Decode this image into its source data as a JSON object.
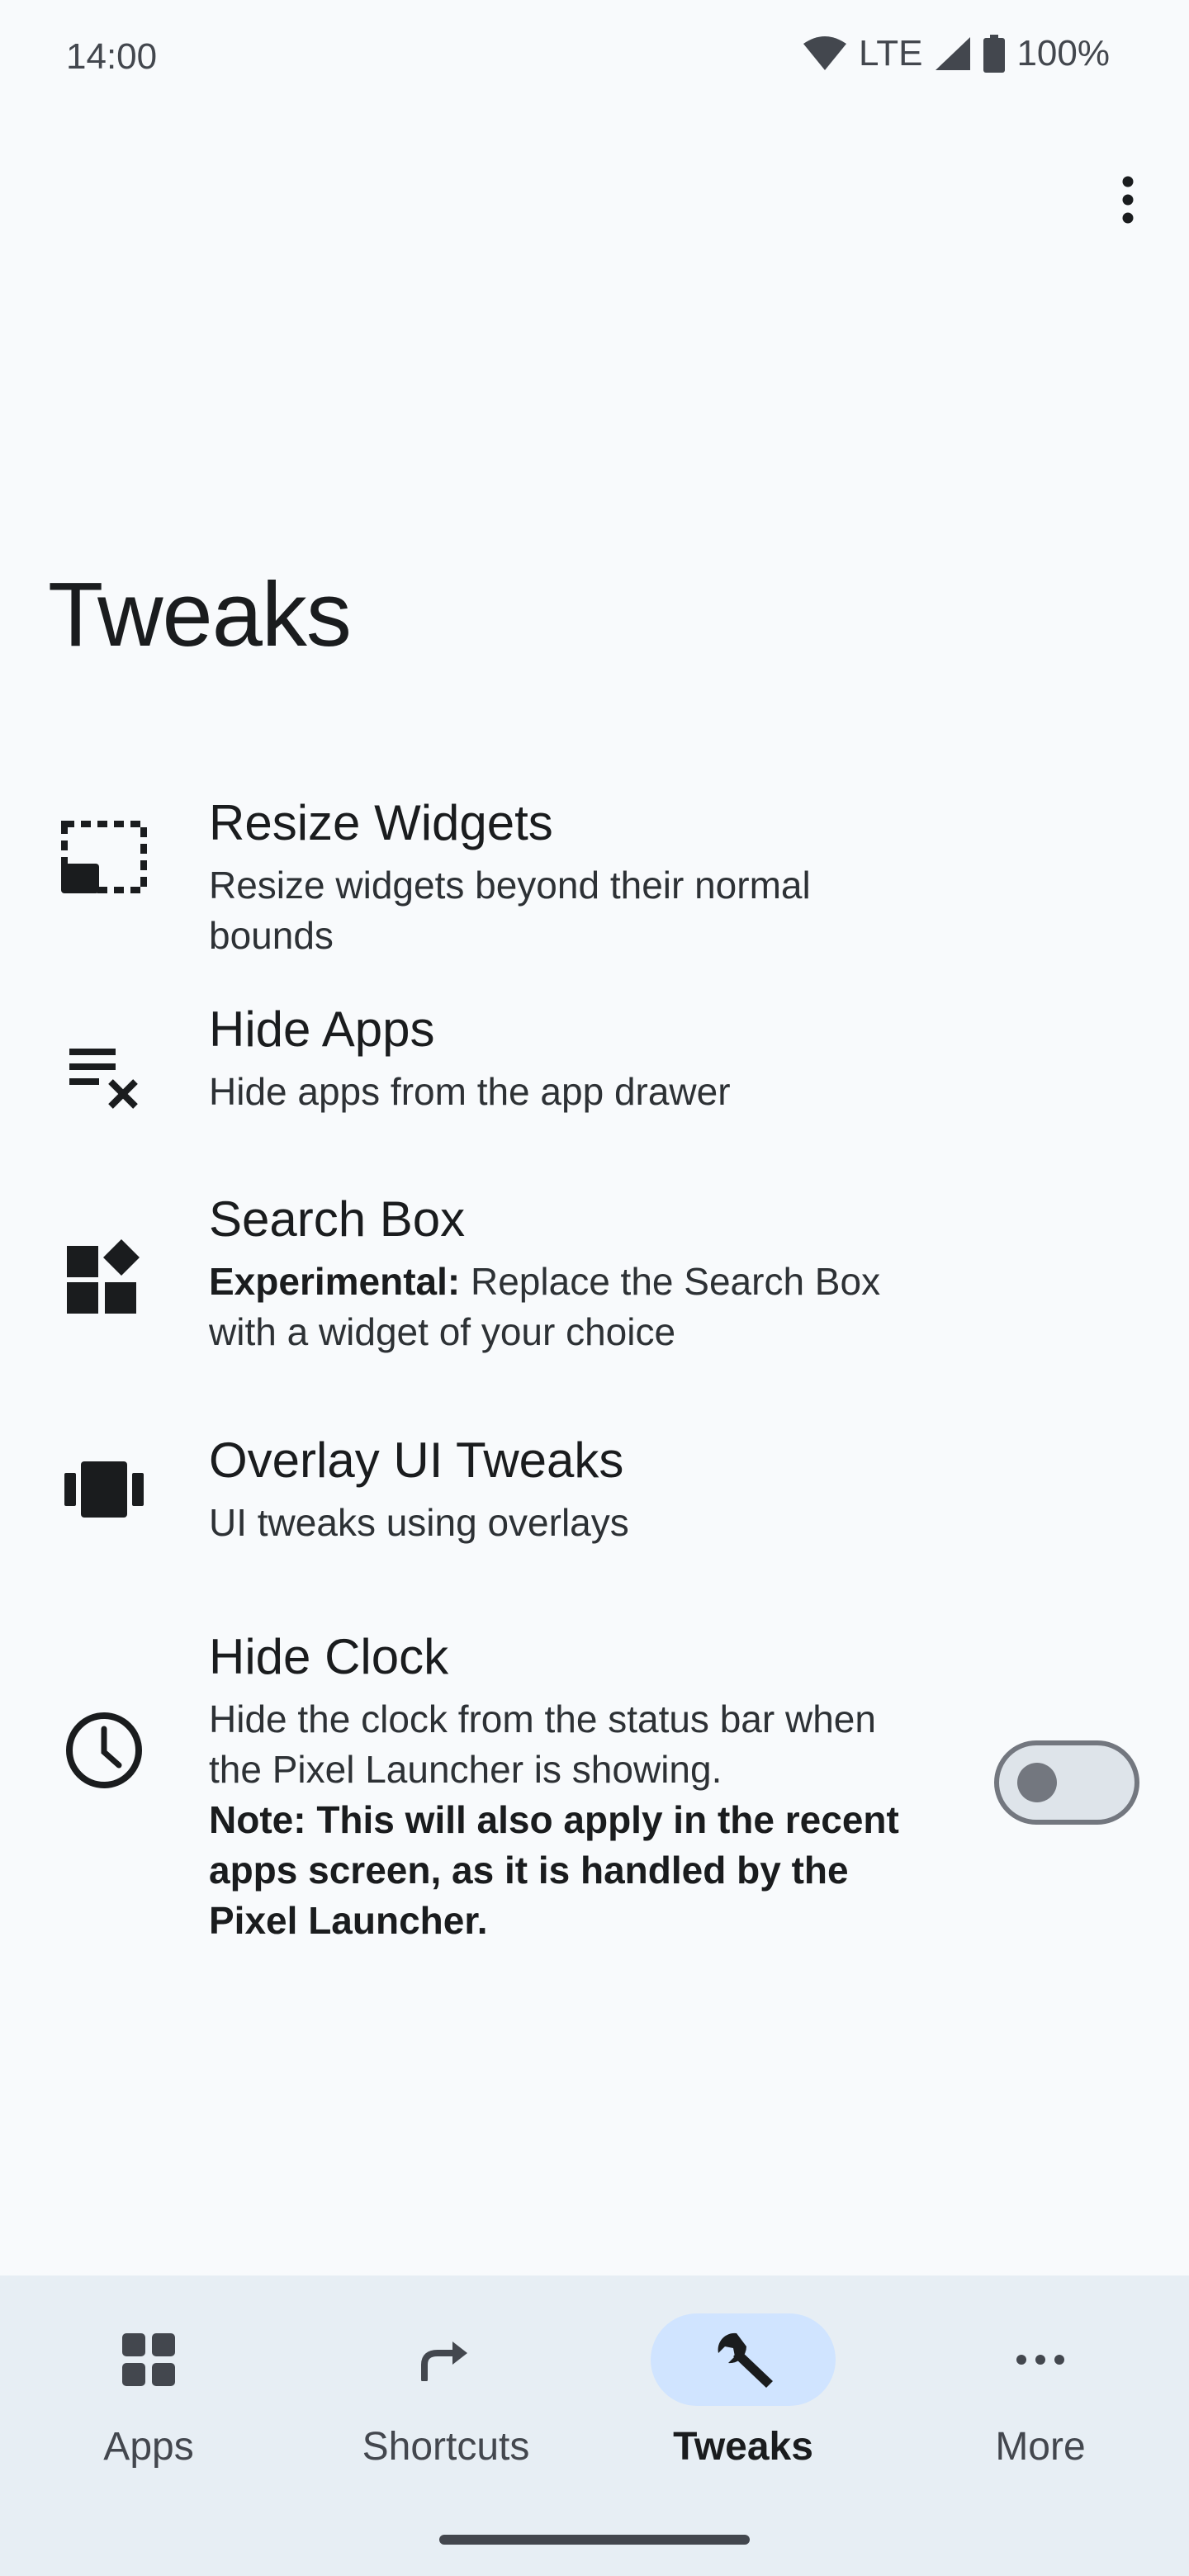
{
  "status_bar": {
    "time": "14:00",
    "network": "LTE",
    "battery": "100%"
  },
  "header": {
    "title": "Tweaks",
    "overflow_icon": "more-vert-icon"
  },
  "items": [
    {
      "title": "Resize Widgets",
      "subtitle": "Resize widgets beyond their normal bounds",
      "icon": "resize-icon"
    },
    {
      "title": "Hide Apps",
      "subtitle": "Hide apps from the app drawer",
      "icon": "playlist-remove-icon"
    },
    {
      "title": "Search Box",
      "subtitle_bold": "Experimental:",
      "subtitle": " Replace the Search Box with a widget of your choice",
      "icon": "widgets-icon"
    },
    {
      "title": "Overlay UI Tweaks",
      "subtitle": "UI tweaks using overlays",
      "icon": "view-carousel-icon"
    },
    {
      "title": "Hide Clock",
      "subtitle": "Hide the clock from the status bar when the Pixel Launcher is showing.",
      "subtitle_note": "Note: This will also apply in the recent apps screen, as it is handled by the Pixel Launcher.",
      "icon": "clock-icon",
      "toggle_on": false
    }
  ],
  "bottom_nav": {
    "items": [
      {
        "label": "Apps",
        "icon": "grid-icon",
        "active": false
      },
      {
        "label": "Shortcuts",
        "icon": "share-arrow-icon",
        "active": false
      },
      {
        "label": "Tweaks",
        "icon": "wrench-icon",
        "active": true
      },
      {
        "label": "More",
        "icon": "more-horiz-icon",
        "active": false
      }
    ]
  },
  "colors": {
    "background": "#F8FAFC",
    "nav_background": "#E7EEF4",
    "active_pill": "#D0E4FF",
    "text": "#1A1C1E"
  }
}
